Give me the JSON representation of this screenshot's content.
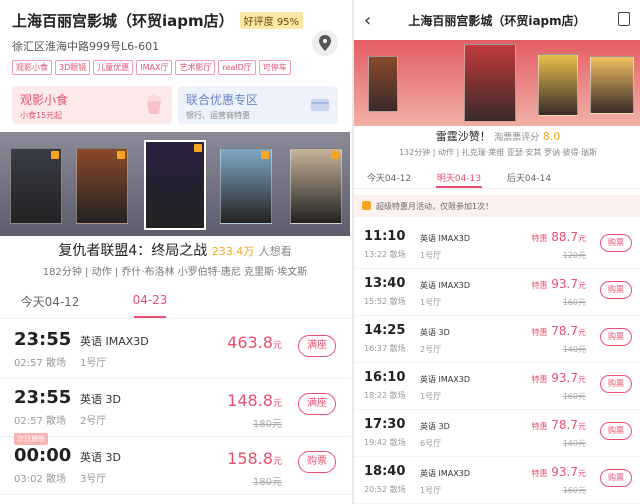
{
  "left": {
    "cinema_name": "上海百丽宫影城（环贸iapm店）",
    "rating_badge": "好评度 95%",
    "address": "徐汇区淮海中路999号L6-601",
    "tags": [
      "观影小食",
      "3D眼镜",
      "儿童优惠",
      "IMAX厅",
      "艺术影厅",
      "realD厅",
      "可停车"
    ],
    "promos": [
      {
        "title": "观影小食",
        "sub": "小食15元起"
      },
      {
        "title": "联合优惠专区",
        "sub": "银行、运营商特惠"
      }
    ],
    "posters": [
      {
        "color": "#3b3d47"
      },
      {
        "color": "#8a4a2a"
      },
      {
        "color": "#2a2040"
      },
      {
        "color": "#7fa8c8"
      },
      {
        "color": "#c6b39a"
      },
      {
        "color": "#e0b24a"
      }
    ],
    "movie": {
      "title": "复仇者联盟4：终局之战",
      "want_count": "233.4万",
      "want_label": "人想看",
      "meta": "182分钟 | 动作 | 乔什·布洛林 小罗伯特·唐尼 克里斯·埃文斯"
    },
    "dates": [
      {
        "label": "今天04-12"
      },
      {
        "label": "04-23"
      }
    ],
    "showtimes": [
      {
        "start": "23:55",
        "end": "02:57 散场",
        "lang": "英语 IMAX3D",
        "hall": "1号厅",
        "price": "463.8",
        "unit": "元",
        "orig": "",
        "button": "满座",
        "next_day": ""
      },
      {
        "start": "23:55",
        "end": "02:57 散场",
        "lang": "英语 3D",
        "hall": "2号厅",
        "price": "148.8",
        "unit": "元",
        "orig": "180元",
        "button": "满座",
        "next_day": ""
      },
      {
        "start": "00:00",
        "end": "03:02 散场",
        "lang": "英语 3D",
        "hall": "3号厅",
        "price": "158.8",
        "unit": "元",
        "orig": "180元",
        "button": "购票",
        "next_day": "次日放映"
      }
    ]
  },
  "right": {
    "title": "上海百丽宫影城（环贸iapm店）",
    "movie": {
      "title": "雷霆沙赞！",
      "score_label": "淘票票评分",
      "score": "8.0",
      "meta": "132分钟 | 动作 | 扎克瑞·莱维 亚瑟·安其 罗讷·彼得·瑞斯"
    },
    "dates": [
      {
        "label": "今天04-12"
      },
      {
        "label": "明天04-13"
      },
      {
        "label": "后天04-14"
      }
    ],
    "notice": "超级特惠月活动，仅限参加1次！",
    "showtimes": [
      {
        "start": "11:10",
        "end": "13:22 散场",
        "lang": "英语 IMAX3D",
        "hall": "1号厅",
        "price_label": "特惠",
        "price": "88.7",
        "unit": "元",
        "orig": "120元",
        "button": "购票"
      },
      {
        "start": "13:40",
        "end": "15:52 散场",
        "lang": "英语 IMAX3D",
        "hall": "1号厅",
        "price_label": "特惠",
        "price": "93.7",
        "unit": "元",
        "orig": "160元",
        "button": "购票"
      },
      {
        "start": "14:25",
        "end": "16:37 散场",
        "lang": "英语 3D",
        "hall": "2号厅",
        "price_label": "特惠",
        "price": "78.7",
        "unit": "元",
        "orig": "140元",
        "button": "购票"
      },
      {
        "start": "16:10",
        "end": "18:22 散场",
        "lang": "英语 IMAX3D",
        "hall": "1号厅",
        "price_label": "特惠",
        "price": "93.7",
        "unit": "元",
        "orig": "160元",
        "button": "购票"
      },
      {
        "start": "17:30",
        "end": "19:42 散场",
        "lang": "英语 3D",
        "hall": "6号厅",
        "price_label": "特惠",
        "price": "78.7",
        "unit": "元",
        "orig": "140元",
        "button": "购票"
      },
      {
        "start": "18:40",
        "end": "20:52 散场",
        "lang": "英语 IMAX3D",
        "hall": "1号厅",
        "price_label": "特惠",
        "price": "93.7",
        "unit": "元",
        "orig": "160元",
        "button": "购票"
      }
    ]
  },
  "colors": {
    "accent": "#e8506f",
    "star": "#f6a623",
    "banner": "#e35d64"
  }
}
